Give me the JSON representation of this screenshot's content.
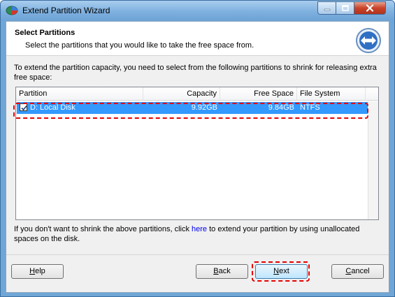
{
  "window": {
    "title": "Extend Partition Wizard",
    "app_icon": "partition-wizard-icon"
  },
  "title_controls": {
    "minimize_icon": "minimize-icon",
    "maximize_icon": "maximize-icon",
    "close_icon": "close-icon"
  },
  "header": {
    "title": "Select Partitions",
    "subtitle": "Select the partitions that you would like to take the free space from.",
    "icon": "extend-arrows-icon"
  },
  "instruction": "To extend the partition capacity, you need to select from the following partitions to shrink for releasing extra free space:",
  "table": {
    "columns": [
      "Partition",
      "Capacity",
      "Free Space",
      "File System"
    ],
    "rows": [
      {
        "checked": true,
        "partition": "D: Local Disk",
        "capacity": "9.92GB",
        "free_space": "9.84GB",
        "file_system": "NTFS"
      }
    ]
  },
  "bottom_text": {
    "before": "If you don't want to shrink the above partitions, click ",
    "link": "here",
    "after": " to extend your partition by using unallocated spaces on the disk."
  },
  "buttons": {
    "help_hotkey": "H",
    "help_rest": "elp",
    "back_hotkey": "B",
    "back_rest": "ack",
    "next_hotkey": "N",
    "next_rest": "ext",
    "cancel_hotkey": "C",
    "cancel_rest": "ancel"
  },
  "colors": {
    "selection": "#3399ff",
    "highlight_annotation": "#e60000",
    "link": "#0000ee"
  }
}
